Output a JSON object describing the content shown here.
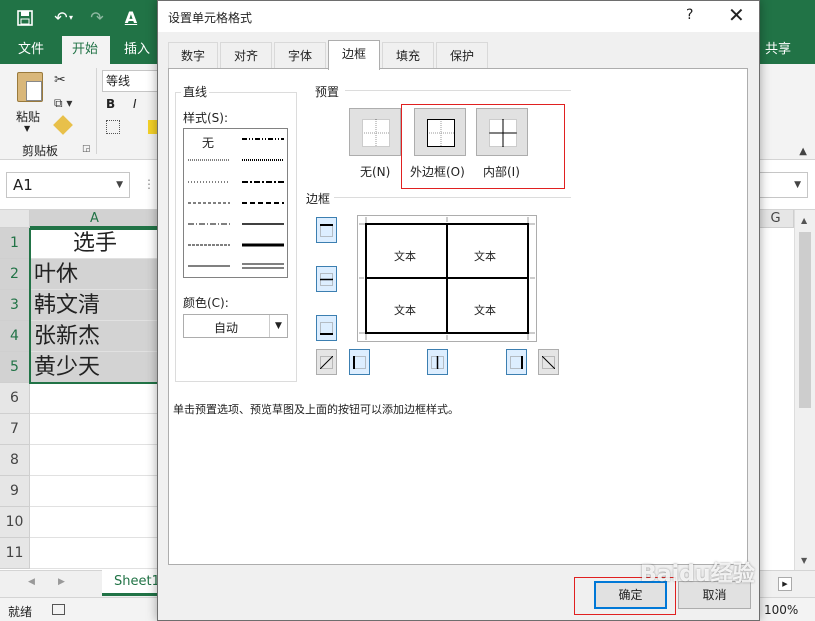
{
  "excel": {
    "quick_access": {
      "save_icon": "save-icon",
      "undo_icon": "undo-icon",
      "redo_icon": "redo-icon",
      "font_color_icon": "font-color-icon",
      "font_color_glyph": "A"
    },
    "ribbon_tabs": [
      "文件",
      "开始",
      "插入"
    ],
    "active_tab": "开始",
    "share_label": "共享",
    "clipboard_group": {
      "paste_label": "粘贴",
      "group_label": "剪贴板"
    },
    "font_name": "等线",
    "bold_label": "B",
    "italic_label": "I",
    "name_box": "A1",
    "column_headers": [
      "A",
      "G"
    ],
    "row_numbers": [
      "1",
      "2",
      "3",
      "4",
      "5",
      "6",
      "7",
      "8",
      "9",
      "10",
      "11"
    ],
    "cells": [
      "选手",
      "叶休",
      "韩文清",
      "张新杰",
      "黄少天"
    ],
    "sheet_tab": "Sheet1",
    "status": "就绪",
    "zoom": "100%"
  },
  "dialog": {
    "title": "设置单元格格式",
    "help": "?",
    "close": "✕",
    "tabs": [
      "数字",
      "对齐",
      "字体",
      "边框",
      "填充",
      "保护"
    ],
    "active_tab": "边框",
    "line_section": "直线",
    "style_label": "样式(S):",
    "style_none": "无",
    "color_label": "颜色(C):",
    "color_value": "自动",
    "presets_section": "预置",
    "presets": [
      "无(N)",
      "外边框(O)",
      "内部(I)"
    ],
    "border_section": "边框",
    "preview_cells": [
      "文本",
      "文本",
      "文本",
      "文本"
    ],
    "hint": "单击预置选项、预览草图及上面的按钮可以添加边框样式。",
    "ok_label": "确定",
    "cancel_label": "取消"
  },
  "watermark": "Baidu经验",
  "colors": {
    "excel_green": "#217346",
    "highlight_red": "#e02020",
    "focus_blue": "#0078d7"
  }
}
